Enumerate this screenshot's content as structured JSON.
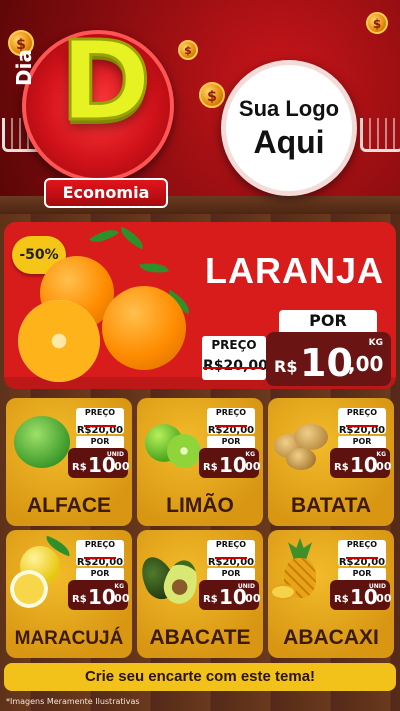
{
  "brand": {
    "prefix": "Dia",
    "letter": "D",
    "banner": "Economia"
  },
  "placeholder_logo": {
    "line1": "Sua Logo",
    "line2": "Aqui"
  },
  "coin_symbol": "$",
  "featured": {
    "discount": "-50%",
    "name": "LARANJA",
    "old_label": "PREÇO",
    "old_price": "R$20,00",
    "por_label": "POR",
    "currency": "R$",
    "price_int": "10",
    "price_cents": ",00",
    "unit": "KG"
  },
  "products": [
    {
      "name": "ALFACE",
      "old_label": "PREÇO",
      "old_price": "R$20,00",
      "por_label": "POR",
      "currency": "R$",
      "price_int": "10",
      "price_cents": ",00",
      "unit": "UNID"
    },
    {
      "name": "LIMÃO",
      "old_label": "PREÇO",
      "old_price": "R$20,00",
      "por_label": "POR",
      "currency": "R$",
      "price_int": "10",
      "price_cents": ",00",
      "unit": "KG"
    },
    {
      "name": "BATATA",
      "old_label": "PREÇO",
      "old_price": "R$20,00",
      "por_label": "POR",
      "currency": "R$",
      "price_int": "10",
      "price_cents": ",00",
      "unit": "KG"
    },
    {
      "name": "MARACUJÁ",
      "old_label": "PREÇO",
      "old_price": "R$20,00",
      "por_label": "POR",
      "currency": "R$",
      "price_int": "10",
      "price_cents": ",00",
      "unit": "KG"
    },
    {
      "name": "ABACATE",
      "old_label": "PREÇO",
      "old_price": "R$20,00",
      "por_label": "POR",
      "currency": "R$",
      "price_int": "10",
      "price_cents": ",00",
      "unit": "UNID"
    },
    {
      "name": "ABACAXI",
      "old_label": "PREÇO",
      "old_price": "R$20,00",
      "por_label": "POR",
      "currency": "R$",
      "price_int": "10",
      "price_cents": ",00",
      "unit": "UNID"
    }
  ],
  "cta": "Crie seu encarte com este tema!",
  "footnote": "*Imagens Meramente Ilustrativas",
  "colors": {
    "hero_red": "#c8151a",
    "featured_red": "#d81c1c",
    "card_yellow": "#e3a515",
    "price_brown": "#5e1210",
    "cta_yellow": "#f2c21a",
    "logo_letter": "#e7f223"
  }
}
